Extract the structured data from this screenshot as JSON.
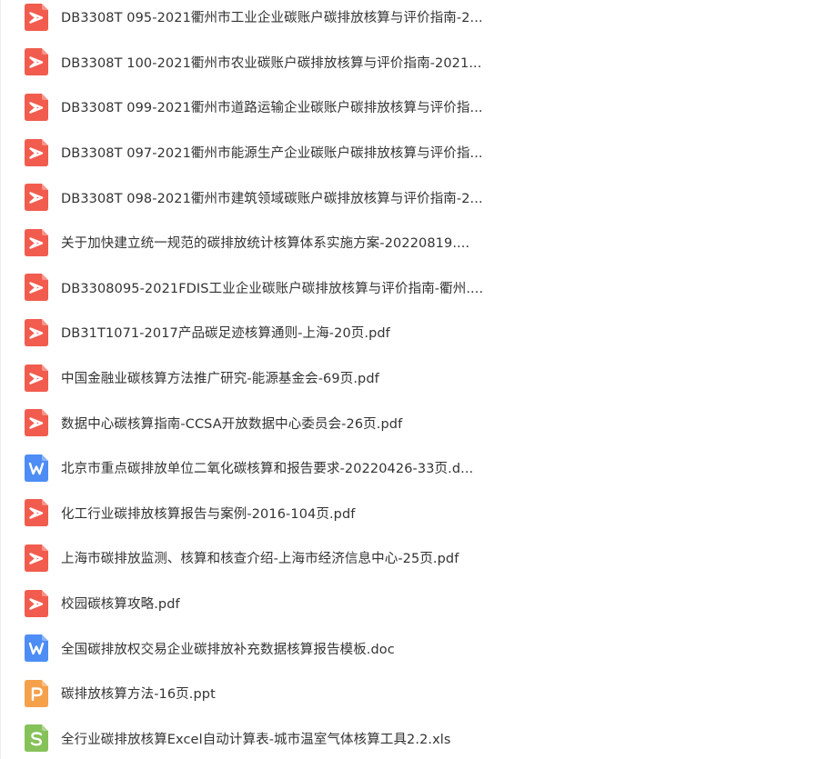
{
  "colors": {
    "pdf": "#f15c4e",
    "doc": "#4d8df5",
    "ppt": "#f5a04b",
    "xls": "#86c15a"
  },
  "files": [
    {
      "name": "DB3308T 095-2021衢州市工业企业碳账户碳排放核算与评价指南-2...",
      "type": "pdf",
      "icon": "pdf-icon"
    },
    {
      "name": "DB3308T 100-2021衢州市农业碳账户碳排放核算与评价指南-2021...",
      "type": "pdf",
      "icon": "pdf-icon"
    },
    {
      "name": "DB3308T 099-2021衢州市道路运输企业碳账户碳排放核算与评价指...",
      "type": "pdf",
      "icon": "pdf-icon"
    },
    {
      "name": "DB3308T 097-2021衢州市能源生产企业碳账户碳排放核算与评价指...",
      "type": "pdf",
      "icon": "pdf-icon"
    },
    {
      "name": "DB3308T 098-2021衢州市建筑领域碳账户碳排放核算与评价指南-2...",
      "type": "pdf",
      "icon": "pdf-icon"
    },
    {
      "name": "关于加快建立统一规范的碳排放统计核算体系实施方案-20220819....",
      "type": "pdf",
      "icon": "pdf-icon"
    },
    {
      "name": "DB3308095-2021FDIS工业企业碳账户碳排放核算与评价指南-衢州....",
      "type": "pdf",
      "icon": "pdf-icon"
    },
    {
      "name": "DB31T1071-2017产品碳足迹核算通则-上海-20页.pdf",
      "type": "pdf",
      "icon": "pdf-icon"
    },
    {
      "name": "中国金融业碳核算方法推广研究-能源基金会-69页.pdf",
      "type": "pdf",
      "icon": "pdf-icon"
    },
    {
      "name": "数据中心碳核算指南-CCSA开放数据中心委员会-26页.pdf",
      "type": "pdf",
      "icon": "pdf-icon"
    },
    {
      "name": "北京市重点碳排放单位二氧化碳核算和报告要求-20220426-33页.d...",
      "type": "doc",
      "icon": "word-icon"
    },
    {
      "name": "化工行业碳排放核算报告与案例-2016-104页.pdf",
      "type": "pdf",
      "icon": "pdf-icon"
    },
    {
      "name": "上海市碳排放监测、核算和核查介绍-上海市经济信息中心-25页.pdf",
      "type": "pdf",
      "icon": "pdf-icon"
    },
    {
      "name": "校园碳核算攻略.pdf",
      "type": "pdf",
      "icon": "pdf-icon"
    },
    {
      "name": "全国碳排放权交易企业碳排放补充数据核算报告模板.doc",
      "type": "doc",
      "icon": "word-icon"
    },
    {
      "name": "碳排放核算方法-16页.ppt",
      "type": "ppt",
      "icon": "powerpoint-icon"
    },
    {
      "name": "全行业碳排放核算Excel自动计算表-城市温室气体核算工具2.2.xls",
      "type": "xls",
      "icon": "excel-icon"
    }
  ]
}
